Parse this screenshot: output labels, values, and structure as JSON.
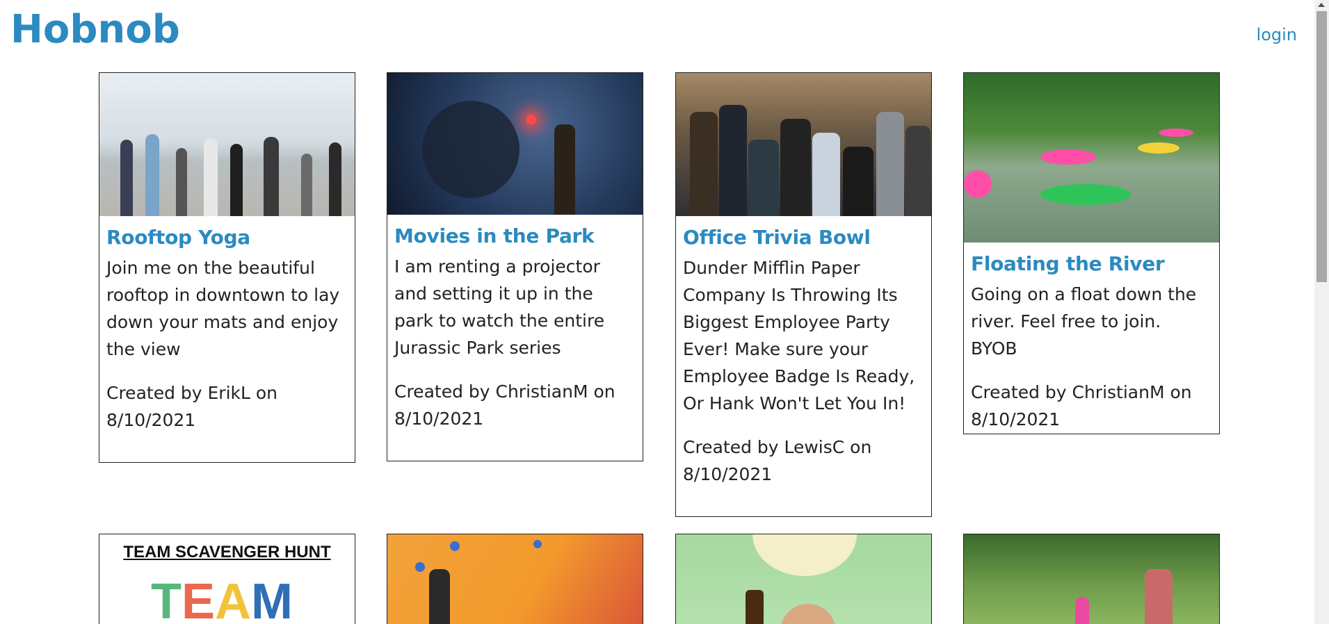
{
  "header": {
    "brand": "Hobnob",
    "login_label": "login"
  },
  "events": [
    {
      "title": "Rooftop Yoga",
      "description": "Join me on the beautiful rooftop in downtown to lay down your mats and enjoy the view",
      "created_line1": "Created by ErikL on",
      "created_line2": "8/10/2021"
    },
    {
      "title": "Movies in the Park",
      "description": "I am renting a projector and setting it up in the park to watch the entire Jurassic Park series",
      "created_line1": "Created by ChristianM on",
      "created_line2": "8/10/2021"
    },
    {
      "title": "Office Trivia Bowl",
      "description": "Dunder Mifflin Paper Company Is Throwing Its Biggest Employee Party Ever! Make sure your Employee Badge Is Ready, Or Hank Won't Let You In!",
      "created_line1": "Created by LewisC on",
      "created_line2": "8/10/2021"
    },
    {
      "title": "Floating the River",
      "description": "Going on a float down the river. Feel free to join. BYOB",
      "created_line1": "Created by ChristianM on",
      "created_line2": "8/10/2021"
    }
  ],
  "second_row": {
    "scavenger_heading": "TEAM SCAVENGER HUNT",
    "scavenger_word": "TEAM"
  },
  "colors": {
    "accent": "#2b8ac0",
    "text": "#222222",
    "border": "#222222"
  }
}
